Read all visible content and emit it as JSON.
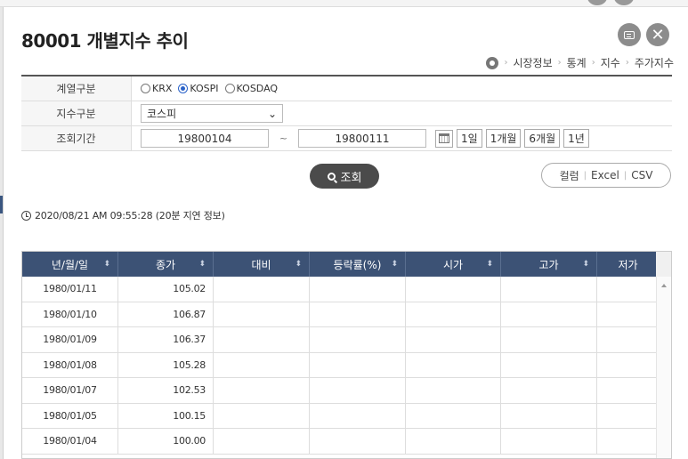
{
  "window": {
    "title": "80001 개별지수 추이",
    "close_label": "✕"
  },
  "breadcrumb": [
    "시장정보",
    "통계",
    "지수",
    "주가지수"
  ],
  "form": {
    "series_label": "계열구분",
    "series_options": [
      "KRX",
      "KOSPI",
      "KOSDAQ"
    ],
    "series_selected": "KOSPI",
    "index_label": "지수구분",
    "index_value": "코스피",
    "period_label": "조회기간",
    "date_from": "19800104",
    "date_sep": "~",
    "date_to": "19800111",
    "period_buttons": [
      "1일",
      "1개월",
      "6개월",
      "1년"
    ]
  },
  "search_label": "조회",
  "export": [
    "컬럼",
    "Excel",
    "CSV"
  ],
  "timestamp": "2020/08/21 AM 09:55:28 (20분 지연 정보)",
  "table": {
    "columns": [
      "년/월/일",
      "종가",
      "대비",
      "등락률(%)",
      "시가",
      "고가",
      "저가"
    ],
    "sortable": [
      true,
      true,
      true,
      true,
      true,
      true,
      false
    ],
    "rows": [
      [
        "1980/01/11",
        "105.02",
        "",
        "",
        "",
        "",
        ""
      ],
      [
        "1980/01/10",
        "106.87",
        "",
        "",
        "",
        "",
        ""
      ],
      [
        "1980/01/09",
        "106.37",
        "",
        "",
        "",
        "",
        ""
      ],
      [
        "1980/01/08",
        "105.28",
        "",
        "",
        "",
        "",
        ""
      ],
      [
        "1980/01/07",
        "102.53",
        "",
        "",
        "",
        "",
        ""
      ],
      [
        "1980/01/05",
        "100.15",
        "",
        "",
        "",
        "",
        ""
      ],
      [
        "1980/01/04",
        "100.00",
        "",
        "",
        "",
        "",
        ""
      ]
    ]
  },
  "colors": {
    "table_header": "#3c5275",
    "search_button": "#4b4b4b",
    "radio_selected": "#2a62c9"
  }
}
